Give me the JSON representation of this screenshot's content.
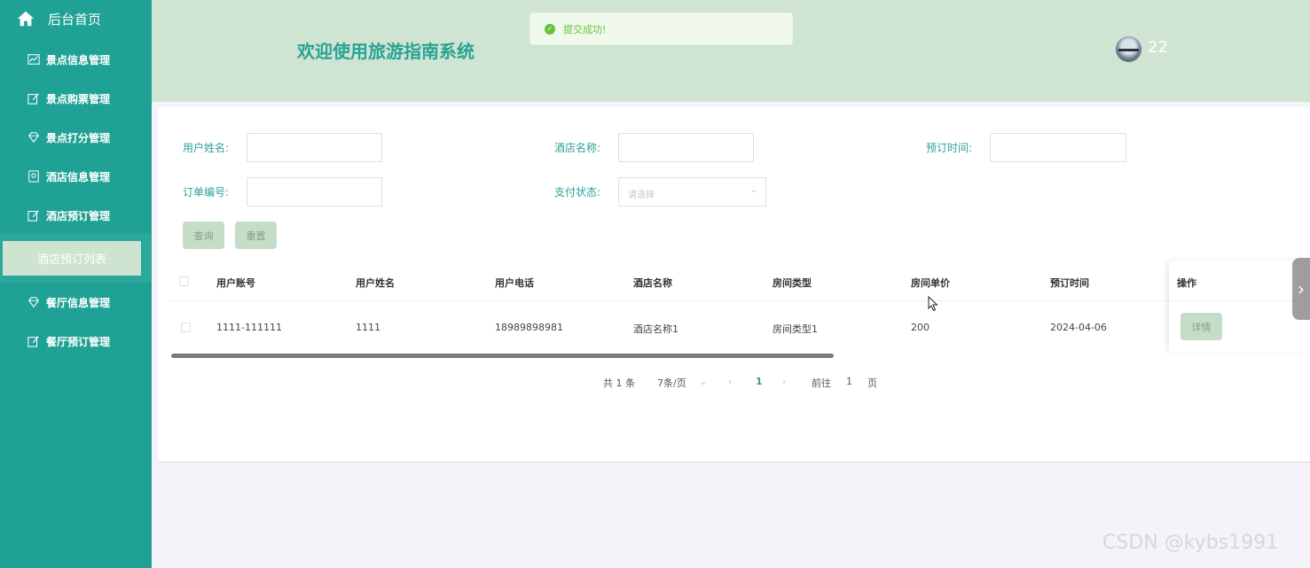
{
  "sidebar": {
    "home_label": "后台首页",
    "items": [
      {
        "label": "景点信息管理",
        "icon": "chart-icon"
      },
      {
        "label": "景点购票管理",
        "icon": "edit-icon"
      },
      {
        "label": "景点打分管理",
        "icon": "diamond-icon"
      },
      {
        "label": "酒店信息管理",
        "icon": "badge-icon"
      },
      {
        "label": "酒店预订管理",
        "icon": "edit-icon"
      },
      {
        "label": "餐厅信息管理",
        "icon": "diamond-icon"
      },
      {
        "label": "餐厅预订管理",
        "icon": "edit-icon"
      }
    ],
    "active_sub_label": "酒店预订列表"
  },
  "header": {
    "title": "欢迎使用旅游指南系统",
    "username": "22"
  },
  "toast": {
    "message": "提交成功!"
  },
  "search": {
    "user_name_label": "用户姓名:",
    "hotel_name_label": "酒店名称:",
    "booking_time_label": "预订时间:",
    "order_no_label": "订单编号:",
    "pay_status_label": "支付状态:",
    "pay_status_placeholder": "请选择",
    "query_button": "查询",
    "reset_button": "重置"
  },
  "table": {
    "columns": [
      "用户账号",
      "用户姓名",
      "用户电话",
      "酒店名称",
      "房间类型",
      "房间单价",
      "预订时间",
      "操作"
    ],
    "rows": [
      {
        "account": "1111-111111",
        "name": "1111",
        "phone": "18989898981",
        "hotel": "酒店名称1",
        "room_type": "房间类型1",
        "price": "200",
        "time": "2024-04-06",
        "action": "详情"
      }
    ]
  },
  "pagination": {
    "total": "共 1 条",
    "page_size": "7条/页",
    "current_page": "1",
    "goto_label": "前往",
    "goto_value": "1",
    "page_suffix": "页"
  },
  "watermark": "CSDN @kybs1991",
  "colors": {
    "sidebar": "#1fa295",
    "header": "#cfe4d3",
    "accent": "#29a394",
    "button": "#c5dcc7"
  }
}
